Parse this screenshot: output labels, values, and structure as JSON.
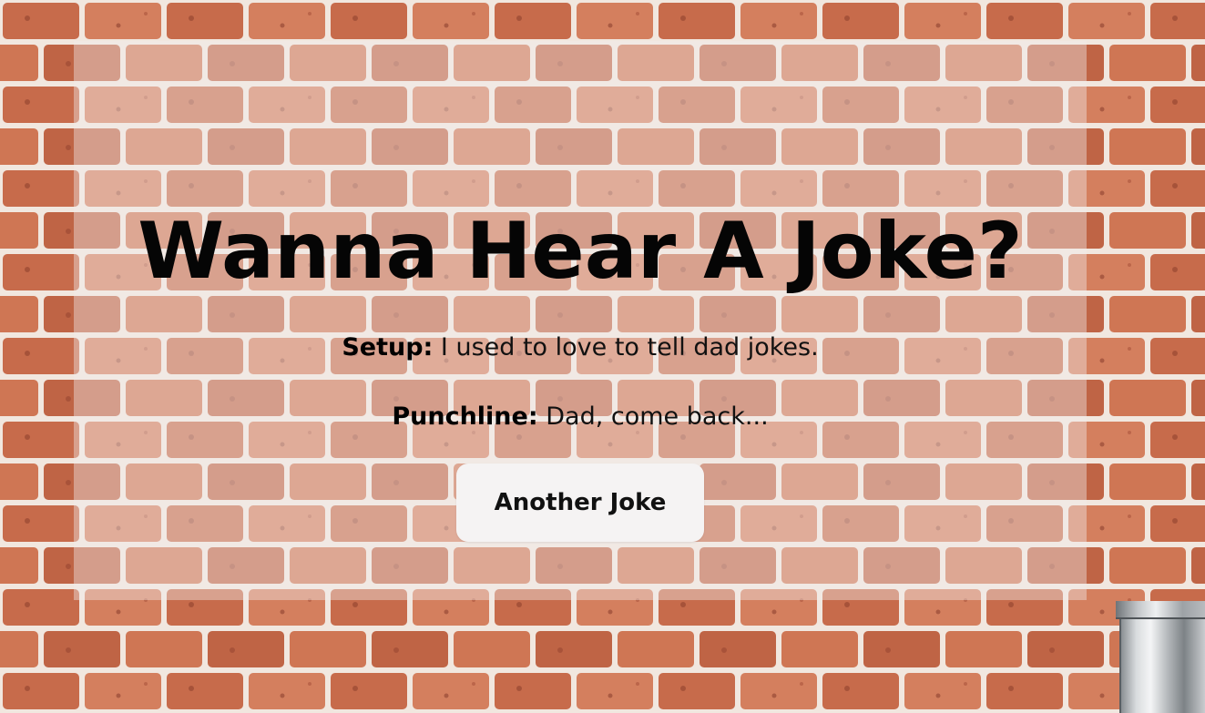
{
  "heading": "Wanna Hear A Joke?",
  "joke": {
    "setup_label": "Setup:",
    "setup_text": " I used to love to tell dad jokes.",
    "punchline_label": "Punchline:",
    "punchline_text": " Dad, come back..."
  },
  "actions": {
    "another_label": "Another Joke"
  },
  "colors": {
    "brick": "#c8714f",
    "mortar": "#f2ece6",
    "panel_overlay": "rgba(240,236,236,0.42)",
    "button_bg": "#f5f3f3",
    "text": "#050505"
  },
  "icons": {
    "background": "brick-wall-texture",
    "decoration": "metal-pipe"
  }
}
